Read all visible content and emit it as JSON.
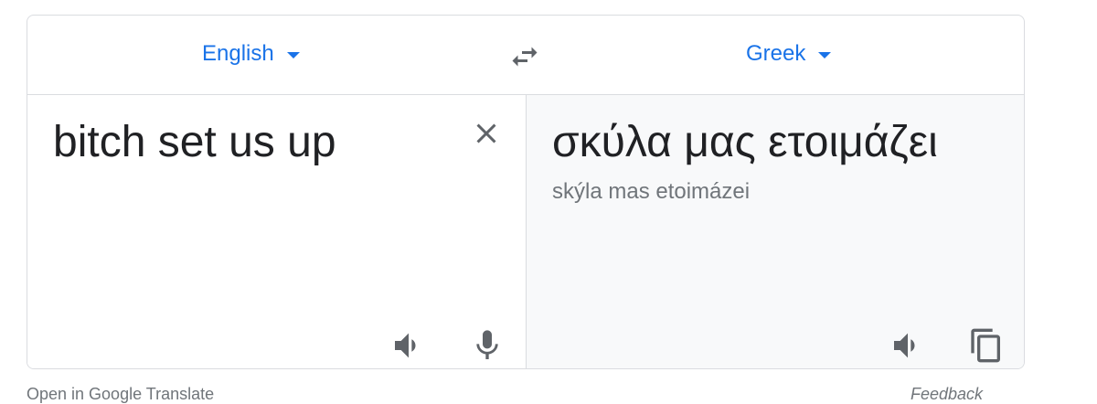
{
  "languages": {
    "source": "English",
    "target": "Greek"
  },
  "source_pane": {
    "text": "bitch set us up"
  },
  "target_pane": {
    "text": "σκύλα μας ετοιμάζει",
    "transliteration": "skýla mas etoimázei"
  },
  "footer": {
    "open_link": "Open in Google Translate",
    "feedback_link": "Feedback"
  },
  "icons": {
    "swap": "swap-arrows-icon",
    "clear": "close-icon",
    "listen": "speaker-icon",
    "voice": "microphone-icon",
    "copy": "copy-icon"
  },
  "colors": {
    "accent": "#1a73e8",
    "icon": "#5f6368",
    "text": "#202124",
    "muted": "#70757a",
    "border": "#dadce0",
    "target_bg": "#f8f9fa"
  }
}
